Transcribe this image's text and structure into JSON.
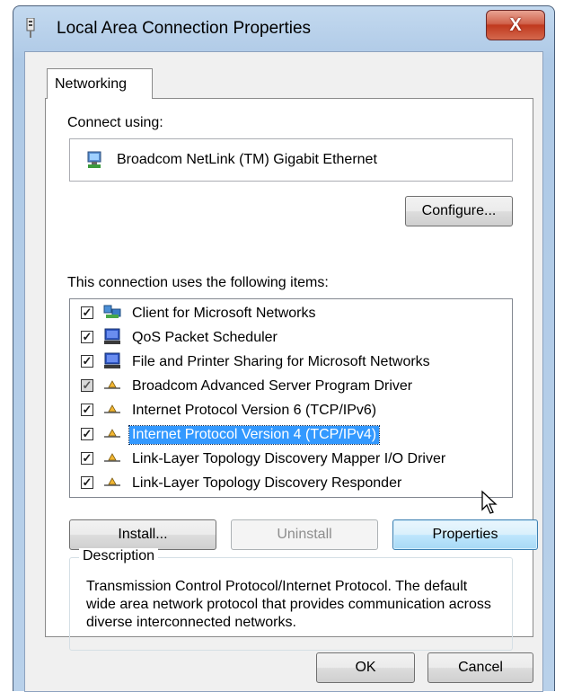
{
  "window": {
    "title": "Local Area Connection Properties",
    "close_label": "X"
  },
  "tabs": [
    {
      "label": "Networking",
      "active": true
    }
  ],
  "connect_using": {
    "label": "Connect using:",
    "adapter_name": "Broadcom NetLink (TM) Gigabit Ethernet",
    "configure_label": "Configure..."
  },
  "items_section": {
    "label": "This connection uses the following items:",
    "items": [
      {
        "label": "Client for Microsoft Networks",
        "checked": true,
        "icon": "network-client-icon"
      },
      {
        "label": "QoS Packet Scheduler",
        "checked": true,
        "icon": "service-icon"
      },
      {
        "label": "File and Printer Sharing for Microsoft Networks",
        "checked": true,
        "icon": "service-icon"
      },
      {
        "label": "Broadcom Advanced Server Program Driver",
        "checked": true,
        "greyed": true,
        "icon": "protocol-icon"
      },
      {
        "label": "Internet Protocol Version 6 (TCP/IPv6)",
        "checked": true,
        "icon": "protocol-icon"
      },
      {
        "label": "Internet Protocol Version 4 (TCP/IPv4)",
        "checked": true,
        "selected": true,
        "icon": "protocol-icon"
      },
      {
        "label": "Link-Layer Topology Discovery Mapper I/O Driver",
        "checked": true,
        "icon": "protocol-icon"
      },
      {
        "label": "Link-Layer Topology Discovery Responder",
        "checked": true,
        "icon": "protocol-icon"
      }
    ]
  },
  "buttons": {
    "install": "Install...",
    "uninstall": "Uninstall",
    "properties": "Properties",
    "ok": "OK",
    "cancel": "Cancel"
  },
  "description": {
    "legend": "Description",
    "text": "Transmission Control Protocol/Internet Protocol. The default wide area network protocol that provides communication across diverse interconnected networks."
  },
  "colors": {
    "selection": "#3399ff",
    "titlebar": "#b9d1ea",
    "close_button": "#c0391e"
  }
}
